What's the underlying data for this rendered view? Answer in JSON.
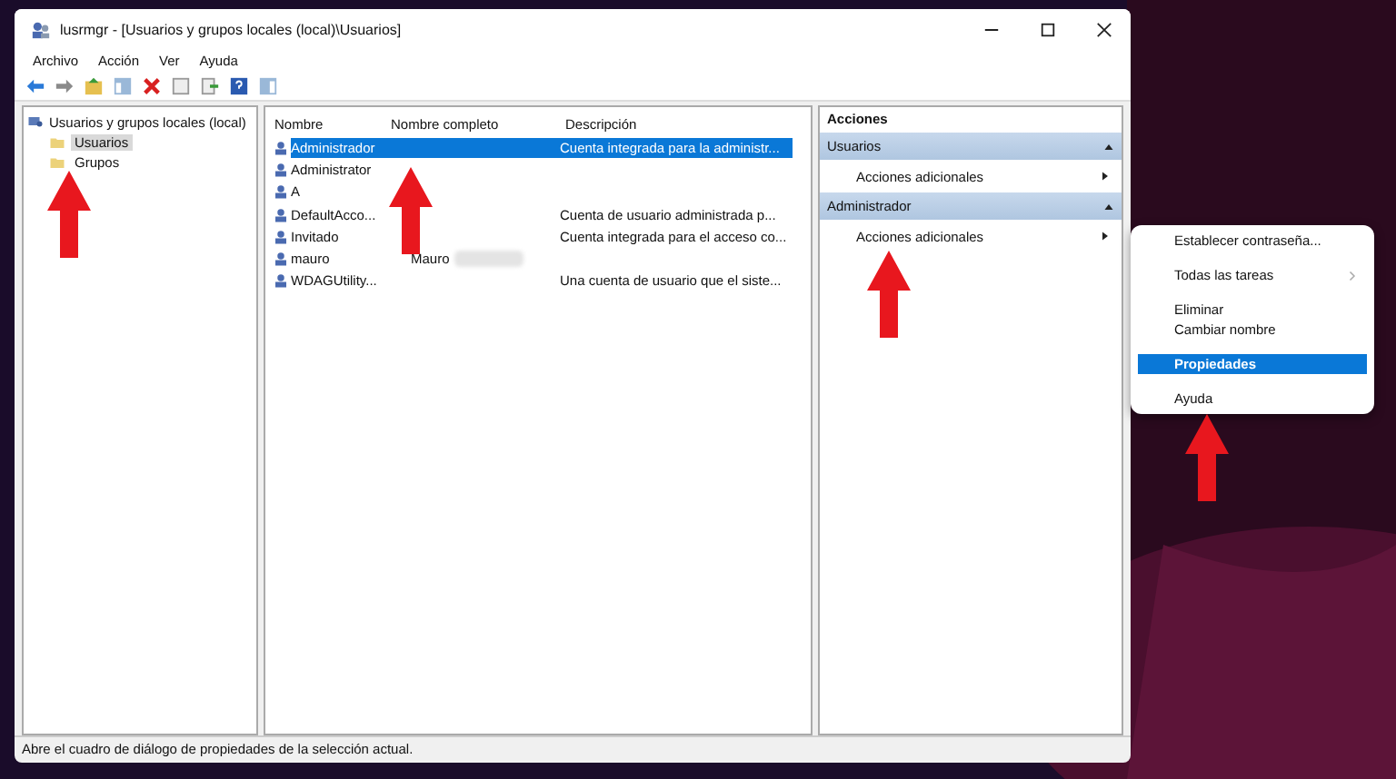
{
  "window": {
    "title": "lusrmgr - [Usuarios y grupos locales (local)\\Usuarios]"
  },
  "menu_bar": [
    "Archivo",
    "Acción",
    "Ver",
    "Ayuda"
  ],
  "tree": {
    "label": "Usuarios y grupos locales (local)",
    "children": [
      {
        "label": "Usuarios",
        "selected": true
      },
      {
        "label": "Grupos",
        "selected": false
      }
    ]
  },
  "list": {
    "columns": [
      "Nombre",
      "Nombre completo",
      "Descripción"
    ],
    "rows": [
      {
        "name": "Administrador",
        "full_name": "",
        "description": "Cuenta integrada para la administr...",
        "selected": true
      },
      {
        "name": "Administrator",
        "full_name": "",
        "description": "",
        "selected": false
      },
      {
        "name": "A",
        "full_name": "",
        "description": "",
        "selected": false
      },
      {
        "name": "DefaultAcco...",
        "full_name": "",
        "description": "Cuenta de usuario administrada p...",
        "selected": false
      },
      {
        "name": "Invitado",
        "full_name": "",
        "description": "Cuenta integrada para el acceso co...",
        "selected": false
      },
      {
        "name": "mauro",
        "full_name": "Mauro",
        "description": "",
        "selected": false,
        "redacted": true
      },
      {
        "name": "WDAGUtility...",
        "full_name": "",
        "description": "Una cuenta de usuario que el siste...",
        "selected": false
      }
    ]
  },
  "actions": {
    "title": "Acciones",
    "sections": [
      {
        "title": "Usuarios",
        "items": [
          "Acciones adicionales"
        ]
      },
      {
        "title": "Administrador",
        "items": [
          "Acciones adicionales"
        ]
      }
    ]
  },
  "context_menu": {
    "items": [
      {
        "kind": "item",
        "label": "Establecer contraseña...",
        "selected": false
      },
      {
        "kind": "separator"
      },
      {
        "kind": "submenu",
        "label": "Todas las tareas",
        "selected": false
      },
      {
        "kind": "separator"
      },
      {
        "kind": "item",
        "label": "Eliminar",
        "selected": false
      },
      {
        "kind": "item",
        "label": "Cambiar nombre",
        "selected": false
      },
      {
        "kind": "separator"
      },
      {
        "kind": "item",
        "label": "Propiedades",
        "selected": true
      },
      {
        "kind": "separator"
      },
      {
        "kind": "item",
        "label": "Ayuda",
        "selected": false
      }
    ]
  },
  "status_bar": "Abre el cuadro de diálogo de propiedades de la selección actual."
}
